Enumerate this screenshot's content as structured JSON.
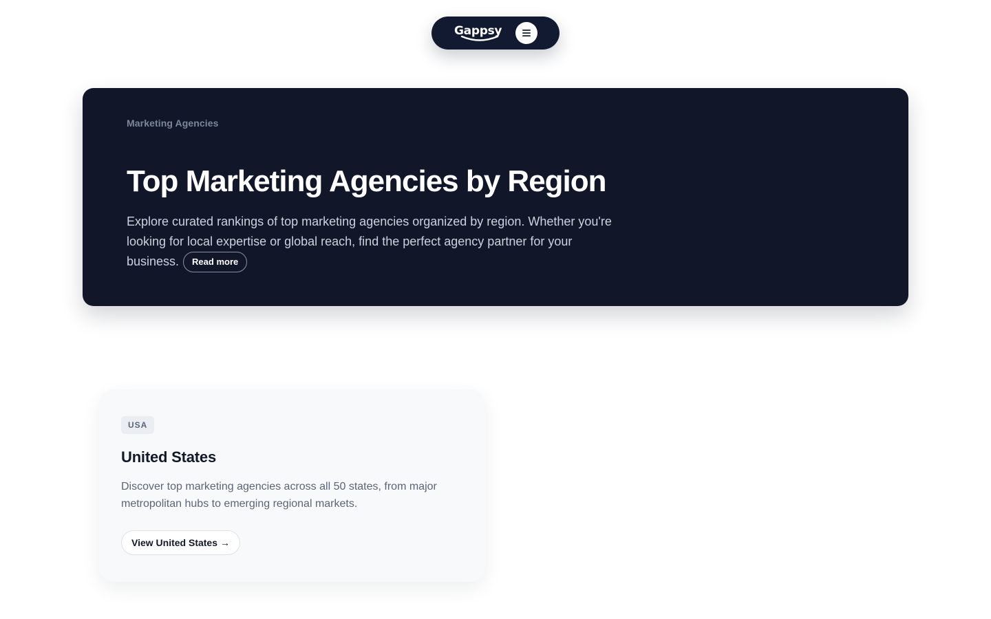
{
  "nav": {
    "logo_text": "Gappsy",
    "menu_icon": "menu-icon",
    "background": "#111a30"
  },
  "hero": {
    "eyebrow": "Marketing Agencies",
    "title": "Top Marketing Agencies by Region",
    "description": "Explore curated rankings of top marketing agencies organized by region. Whether you're looking for local expertise or global reach, find the perfect agency partner for your business.",
    "read_more_label": "Read more",
    "background": "#111729"
  },
  "regions": [
    {
      "badge": "USA",
      "title": "United States",
      "description": "Discover top marketing agencies across all 50 states, from major metropolitan hubs to emerging regional markets.",
      "button_label": "View United States",
      "button_icon": "arrow-right-icon",
      "button_arrow": "→"
    }
  ]
}
